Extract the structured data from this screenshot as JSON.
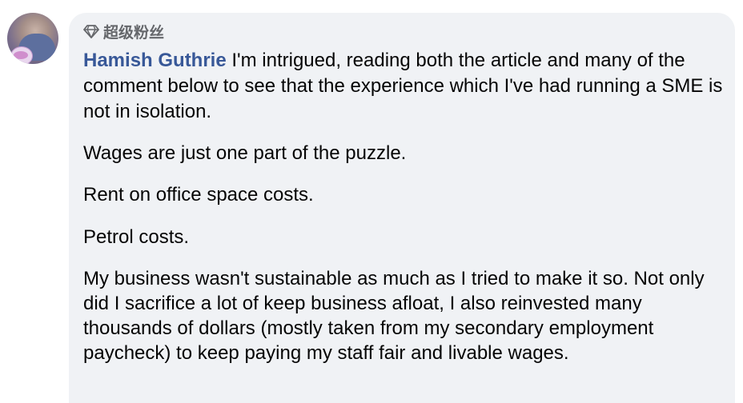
{
  "comment": {
    "badge": {
      "icon": "diamond-icon",
      "label": "超级粉丝"
    },
    "author": "Hamish Guthrie",
    "paragraphs": [
      "I'm intrigued, reading both the article and many of the comment below to see that the experience which I've had running a SME is not in isolation.",
      "Wages are just one part of the puzzle.",
      "Rent on office space costs.",
      "Petrol costs.",
      "My business wasn't sustainable as much as I tried to make it so. Not only did I sacrifice a lot of keep business afloat, I also reinvested many thousands of dollars (mostly taken from my secondary employment paycheck) to keep paying my staff fair and livable wages."
    ]
  },
  "colors": {
    "bubble": "#f0f2f5",
    "author": "#385898",
    "text": "#050505",
    "badge": "#65676b"
  }
}
